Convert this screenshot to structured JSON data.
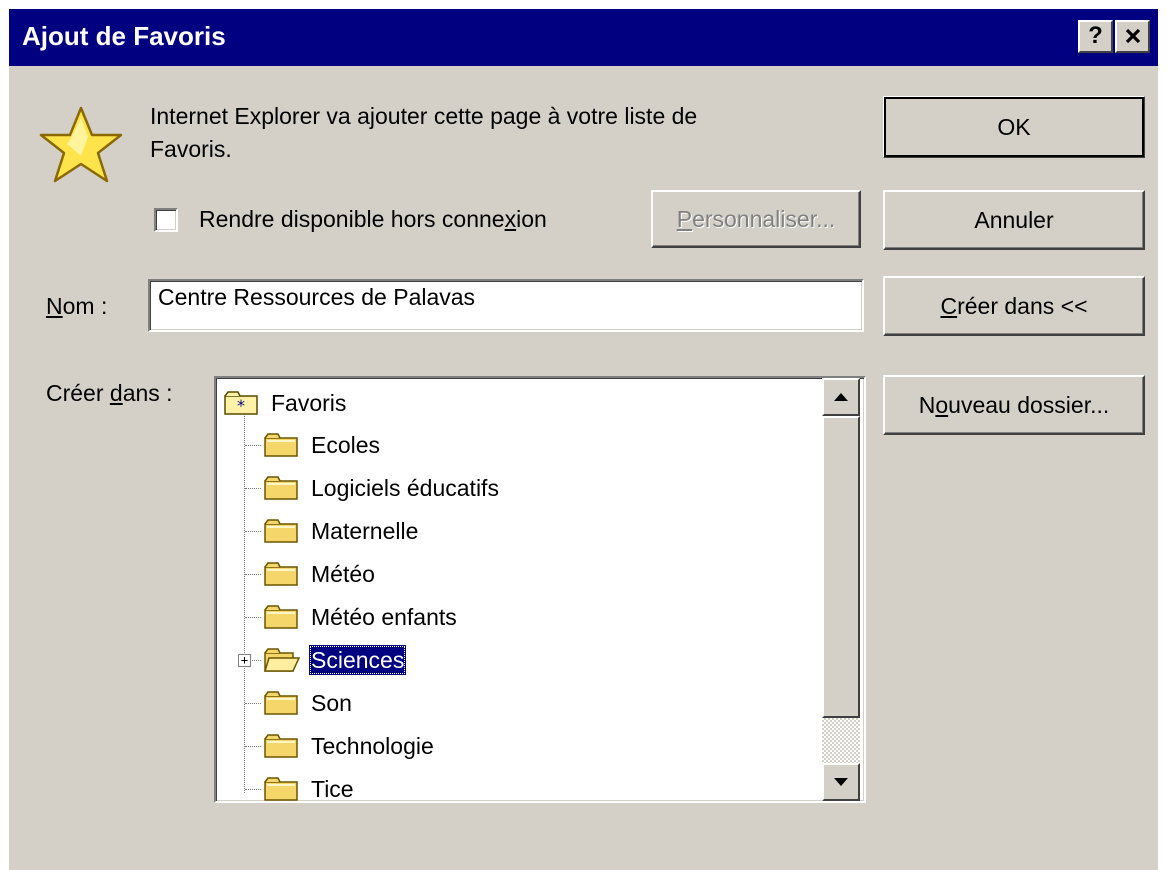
{
  "window": {
    "title": "Ajout de Favoris",
    "help_label": "?",
    "close_label": "✕"
  },
  "message": {
    "line1": "Internet Explorer va ajouter cette page à votre liste de",
    "line2": "Favoris."
  },
  "offline": {
    "checked": false,
    "label_before": "Rendre disponible hors conne",
    "label_accel": "x",
    "label_after": "ion"
  },
  "buttons": {
    "ok": "OK",
    "cancel": "Annuler",
    "create_in_accel": "C",
    "create_in_rest": "réer dans <<",
    "customize_accel": "P",
    "customize_rest": "ersonnaliser...",
    "new_folder_before": "N",
    "new_folder_accel": "o",
    "new_folder_after": "uveau dossier..."
  },
  "name_field": {
    "label_accel": "N",
    "label_rest": "om :",
    "value": "Centre Ressources de Palavas"
  },
  "create_in": {
    "label_before": "Créer ",
    "label_accel": "d",
    "label_after": "ans :"
  },
  "tree": {
    "root": "Favoris",
    "items": [
      {
        "label": "Ecoles"
      },
      {
        "label": "Logiciels éducatifs"
      },
      {
        "label": "Maternelle"
      },
      {
        "label": "Météo"
      },
      {
        "label": "Météo enfants"
      },
      {
        "label": "Sciences",
        "selected": true,
        "expandable": true
      },
      {
        "label": "Son"
      },
      {
        "label": "Technologie"
      },
      {
        "label": "Tice"
      }
    ]
  },
  "colors": {
    "titlebar": "#000080",
    "face": "#d4d0c8",
    "selection": "#000080"
  },
  "icons": {
    "star": "favorites-star-icon",
    "folder": "folder-icon",
    "favorites_folder": "favorites-folder-icon"
  }
}
